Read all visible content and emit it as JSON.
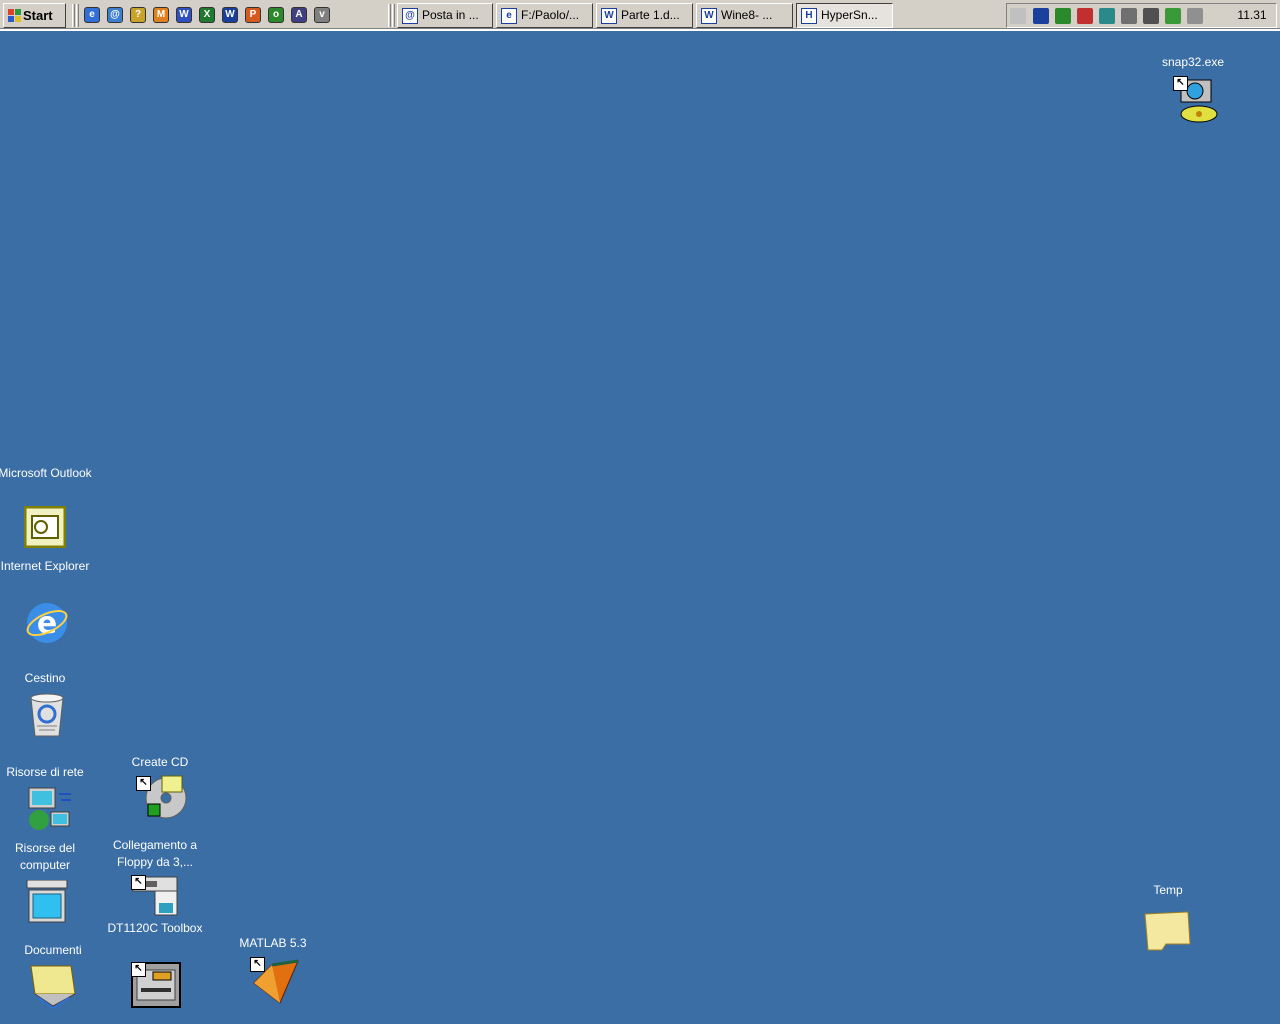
{
  "taskbar": {
    "start_label": "Start",
    "quick_launch": [
      {
        "name": "internet-explorer-icon",
        "color": "#2f6fd6",
        "glyph": "e"
      },
      {
        "name": "outlook-express-icon",
        "color": "#3c7fd0",
        "glyph": "@"
      },
      {
        "name": "word-dictionary-icon",
        "color": "#c9a22a",
        "glyph": "?"
      },
      {
        "name": "matlab-icon",
        "color": "#e08020",
        "glyph": "M"
      },
      {
        "name": "winzip-icon",
        "color": "#3050c0",
        "glyph": "W"
      },
      {
        "name": "excel-icon",
        "color": "#1f7a2f",
        "glyph": "X"
      },
      {
        "name": "word-icon",
        "color": "#1a3f9c",
        "glyph": "W"
      },
      {
        "name": "powerpoint-icon",
        "color": "#d45a20",
        "glyph": "P"
      },
      {
        "name": "network-globe-icon",
        "color": "#2a8a2a",
        "glyph": "o"
      },
      {
        "name": "audio-icon",
        "color": "#404080",
        "glyph": "A"
      },
      {
        "name": "viewer-icon",
        "color": "#808080",
        "glyph": "v"
      }
    ],
    "tasks": [
      {
        "label": "Posta in ...",
        "icon": "outlook-express-icon",
        "icon_glyph": "@"
      },
      {
        "label": "F:/Paolo/...",
        "icon": "explorer-folder-icon",
        "icon_glyph": "e"
      },
      {
        "label": "Parte 1.d...",
        "icon": "word-document-icon",
        "icon_glyph": "W"
      },
      {
        "label": "Wine8- ...",
        "icon": "word-document-icon",
        "icon_glyph": "W"
      },
      {
        "label": "HyperSn...",
        "icon": "hypersnap-icon",
        "icon_glyph": "H"
      }
    ],
    "tray_icons": [
      {
        "name": "volume-icon",
        "color": "#c0c0c0"
      },
      {
        "name": "language-it-icon",
        "color": "#1a3f9c"
      },
      {
        "name": "network-globe-icon",
        "color": "#2a8a2a"
      },
      {
        "name": "scheduler-icon",
        "color": "#c03030"
      },
      {
        "name": "antivirus-icon",
        "color": "#2a8a8a"
      },
      {
        "name": "printer-icon",
        "color": "#707070"
      },
      {
        "name": "computer-monitor-icon",
        "color": "#505050"
      },
      {
        "name": "globe-green-icon",
        "color": "#3a9a3a"
      },
      {
        "name": "display-settings-icon",
        "color": "#909090"
      }
    ],
    "clock": "11.31"
  },
  "desktop": {
    "icons": [
      {
        "id": "snap32",
        "name": "snap32-exe-icon",
        "label": "snap32.exe"
      },
      {
        "id": "outlook",
        "name": "microsoft-outlook-icon",
        "label": "Microsoft Outlook"
      },
      {
        "id": "ie",
        "name": "internet-explorer-icon",
        "label": "Internet Explorer"
      },
      {
        "id": "cestino",
        "name": "recycle-bin-icon",
        "label": "Cestino"
      },
      {
        "id": "risorse-rete",
        "name": "network-neighborhood-icon",
        "label": "Risorse di rete"
      },
      {
        "id": "create-cd",
        "name": "create-cd-icon",
        "label": "Create CD"
      },
      {
        "id": "risorse-computer",
        "name": "my-computer-icon",
        "label": "Risorse del computer"
      },
      {
        "id": "floppy",
        "name": "floppy-shortcut-icon",
        "label": "Collegamento a Floppy da 3,..."
      },
      {
        "id": "documenti",
        "name": "my-documents-icon",
        "label": "Documenti"
      },
      {
        "id": "dt1120c",
        "name": "toolbox-icon",
        "label": "DT1120C Toolbox"
      },
      {
        "id": "matlab",
        "name": "matlab-icon",
        "label": "MATLAB 5.3"
      },
      {
        "id": "temp",
        "name": "folder-icon",
        "label": "Temp"
      }
    ]
  },
  "colors": {
    "desktop": "#3a6ea5",
    "taskbar": "#d4d0c8"
  }
}
